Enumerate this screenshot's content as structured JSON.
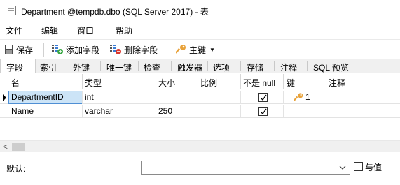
{
  "window": {
    "title": "Department @tempdb.dbo (SQL Server 2017) - 表"
  },
  "menu": [
    "文件",
    "编辑",
    "窗口",
    "帮助"
  ],
  "toolbar": {
    "save": "保存",
    "add_field": "添加字段",
    "delete_field": "删除字段",
    "primary_key": "主键"
  },
  "tabs": [
    "字段",
    "索引",
    "外键",
    "唯一键",
    "检查",
    "触发器",
    "选项",
    "存储",
    "注释",
    "SQL 预览"
  ],
  "grid": {
    "headers": [
      "名",
      "类型",
      "大小",
      "比例",
      "不是 null",
      "键",
      "注释"
    ],
    "rows": [
      {
        "name": "DepartmentID",
        "type": "int",
        "size": "",
        "scale": "",
        "not_null": true,
        "key": "1",
        "comment": ""
      },
      {
        "name": "Name",
        "type": "varchar",
        "size": "250",
        "scale": "",
        "not_null": true,
        "key": "",
        "comment": ""
      }
    ]
  },
  "footer": {
    "default_label": "默认:",
    "default_value": "",
    "or_value_label": "与值"
  },
  "colors": {
    "key_icon": "#e8a23a",
    "selection": "#cce4f7",
    "selection_border": "#4f8fd4"
  }
}
